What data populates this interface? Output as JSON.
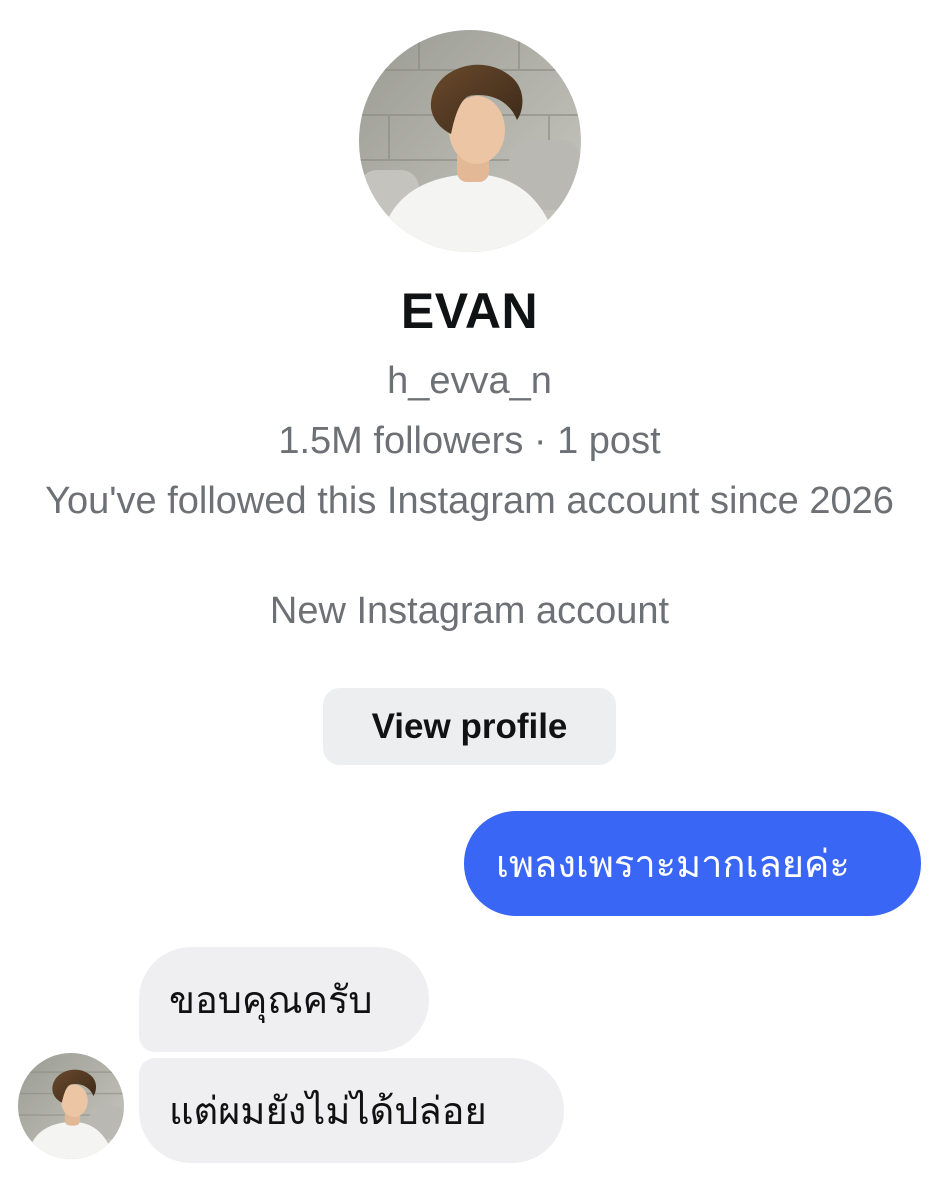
{
  "profile": {
    "avatar_icon": "profile-photo",
    "name": "EVAN",
    "username": "h_evva_n",
    "followers": "1.5M followers · 1 post",
    "followed_since": "You've followed this Instagram account since 2026",
    "account_note": "New Instagram account",
    "view_profile_label": "View profile"
  },
  "messages": [
    {
      "direction": "outgoing",
      "text": "เพลงเพราะมากเลยค่ะ"
    },
    {
      "direction": "incoming",
      "text": "ขอบคุณครับ"
    },
    {
      "direction": "incoming",
      "text": "แต่ผมยังไม่ได้ปล่อย"
    }
  ],
  "colors": {
    "outgoing_bubble": "#3a66f5",
    "incoming_bubble": "#efeff1",
    "meta_text": "#6d7176",
    "button_bg": "#eceef0"
  }
}
